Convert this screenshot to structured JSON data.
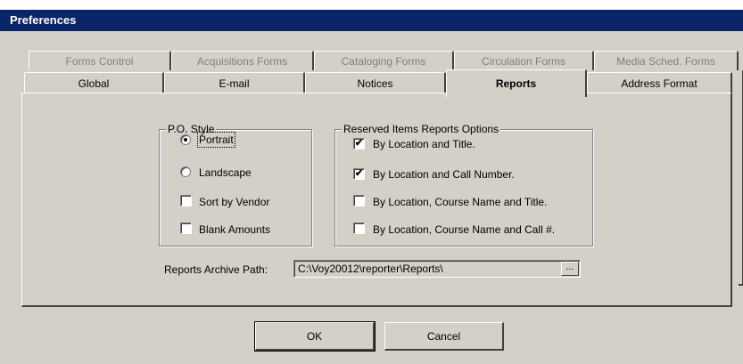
{
  "window": {
    "title": "Preferences"
  },
  "tabs_back": [
    {
      "label": "Forms Control"
    },
    {
      "label": "Acquisitions Forms"
    },
    {
      "label": "Cataloging Forms"
    },
    {
      "label": "Circulation Forms"
    },
    {
      "label": "Media Sched. Forms"
    }
  ],
  "tabs_front": [
    {
      "label": "Global"
    },
    {
      "label": "E-mail"
    },
    {
      "label": "Notices"
    },
    {
      "label": "Reports",
      "selected": true
    },
    {
      "label": "Address Format"
    }
  ],
  "po_style": {
    "title": "P.O. Style",
    "portrait": {
      "label": "Portrait",
      "checked": true
    },
    "landscape": {
      "label": "Landscape",
      "checked": false
    },
    "sort_by_vendor": {
      "label": "Sort by Vendor",
      "checked": false
    },
    "blank_amounts": {
      "label": "Blank Amounts",
      "checked": false
    }
  },
  "reserved": {
    "title": "Reserved Items Reports Options",
    "options": [
      {
        "label": "By Location and Title.",
        "checked": true
      },
      {
        "label": "By Location and Call Number.",
        "checked": true
      },
      {
        "label": "By Location, Course Name and Title.",
        "checked": false
      },
      {
        "label": "By Location, Course Name and Call #.",
        "checked": false
      }
    ]
  },
  "archive": {
    "label": "Reports Archive Path:",
    "value": "C:\\Voy20012\\reporter\\Reports\\",
    "browse_label": "..."
  },
  "buttons": {
    "ok": "OK",
    "cancel": "Cancel"
  },
  "check_glyph": "✔"
}
